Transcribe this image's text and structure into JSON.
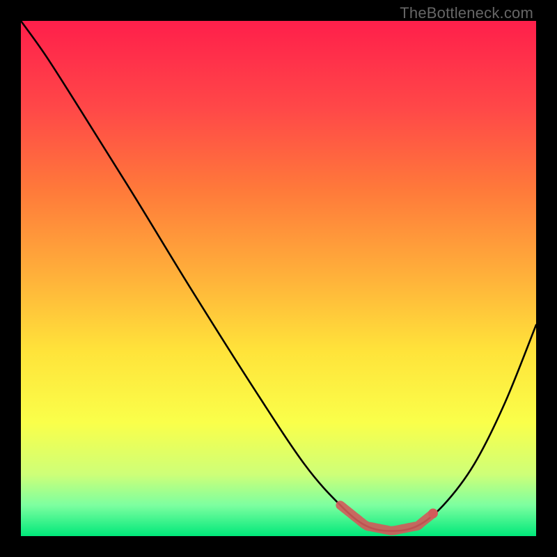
{
  "watermark": "TheBottleneck.com",
  "chart_data": {
    "type": "line",
    "title": "",
    "xlabel": "",
    "ylabel": "",
    "xlim": [
      0,
      1
    ],
    "ylim": [
      0,
      1
    ],
    "series": [
      {
        "name": "bottleneck-curve",
        "x": [
          0.0,
          0.05,
          0.12,
          0.22,
          0.33,
          0.45,
          0.55,
          0.62,
          0.67,
          0.72,
          0.77,
          0.82,
          0.88,
          0.94,
          1.0
        ],
        "y": [
          1.0,
          0.93,
          0.82,
          0.66,
          0.48,
          0.29,
          0.14,
          0.06,
          0.02,
          0.01,
          0.02,
          0.06,
          0.14,
          0.26,
          0.41
        ]
      }
    ],
    "highlight_segment": {
      "x_start": 0.62,
      "x_end": 0.8
    },
    "gradient_stops": [
      {
        "offset": 0.0,
        "color": "#ff1f4b"
      },
      {
        "offset": 0.17,
        "color": "#ff4848"
      },
      {
        "offset": 0.33,
        "color": "#ff7a3a"
      },
      {
        "offset": 0.5,
        "color": "#ffb23a"
      },
      {
        "offset": 0.64,
        "color": "#ffe33a"
      },
      {
        "offset": 0.78,
        "color": "#faff4a"
      },
      {
        "offset": 0.88,
        "color": "#ceff78"
      },
      {
        "offset": 0.94,
        "color": "#7dffa0"
      },
      {
        "offset": 1.0,
        "color": "#00e87a"
      }
    ]
  }
}
